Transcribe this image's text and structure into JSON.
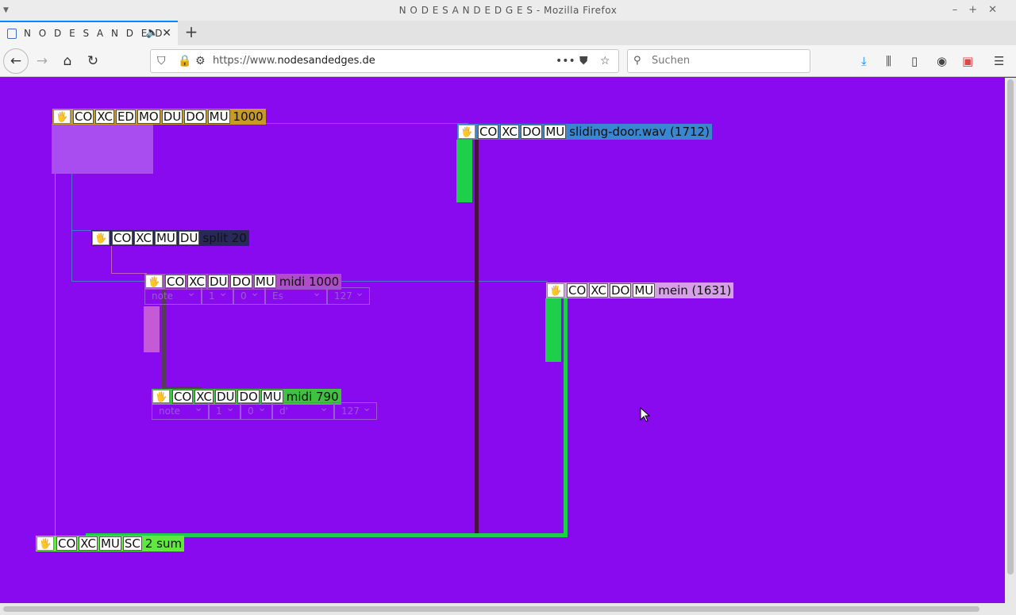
{
  "browser": {
    "window_title": "N O D E S A N D E D G E S - Mozilla Firefox",
    "tab_title": "N O D E S A N D E D G E S",
    "url_prefix": "https://www.",
    "url_domain": "nodesandedges.de",
    "search_placeholder": "Suchen"
  },
  "nodes": {
    "main": {
      "buttons": [
        "CO",
        "XC",
        "ED",
        "MO",
        "DU",
        "DO",
        "MU"
      ],
      "label": "1000",
      "label_bg": "#c6992a"
    },
    "sliding": {
      "buttons": [
        "CO",
        "XC",
        "DO",
        "MU"
      ],
      "label": "sliding-door.wav (1712)",
      "label_bg": "#3b86d1"
    },
    "split": {
      "buttons": [
        "CO",
        "XC",
        "MU",
        "DU"
      ],
      "label": "split 20",
      "label_bg": "#28285a"
    },
    "midi1000": {
      "buttons": [
        "CO",
        "XC",
        "DU",
        "DO",
        "MU"
      ],
      "label": "midi 1000",
      "label_bg": "#b04cc8",
      "selects": [
        "note",
        "1",
        "0",
        "Es",
        "127"
      ]
    },
    "mein": {
      "buttons": [
        "CO",
        "XC",
        "DO",
        "MU"
      ],
      "label": "mein (1631)",
      "label_bg": "#d6a0e6"
    },
    "midi790": {
      "buttons": [
        "CO",
        "XC",
        "DU",
        "DO",
        "MU"
      ],
      "label": "midi 790",
      "label_bg": "#3fc23f",
      "selects": [
        "note",
        "1",
        "0",
        "d'",
        "127"
      ]
    },
    "sum": {
      "buttons": [
        "CO",
        "XC",
        "MU",
        "SC"
      ],
      "label": "2 sum",
      "label_bg": "#5fe83f"
    }
  },
  "colors": {
    "canvas_bg": "#8a0af0",
    "green_wire": "#1fcf4b",
    "dark_wire": "#4a1040"
  }
}
